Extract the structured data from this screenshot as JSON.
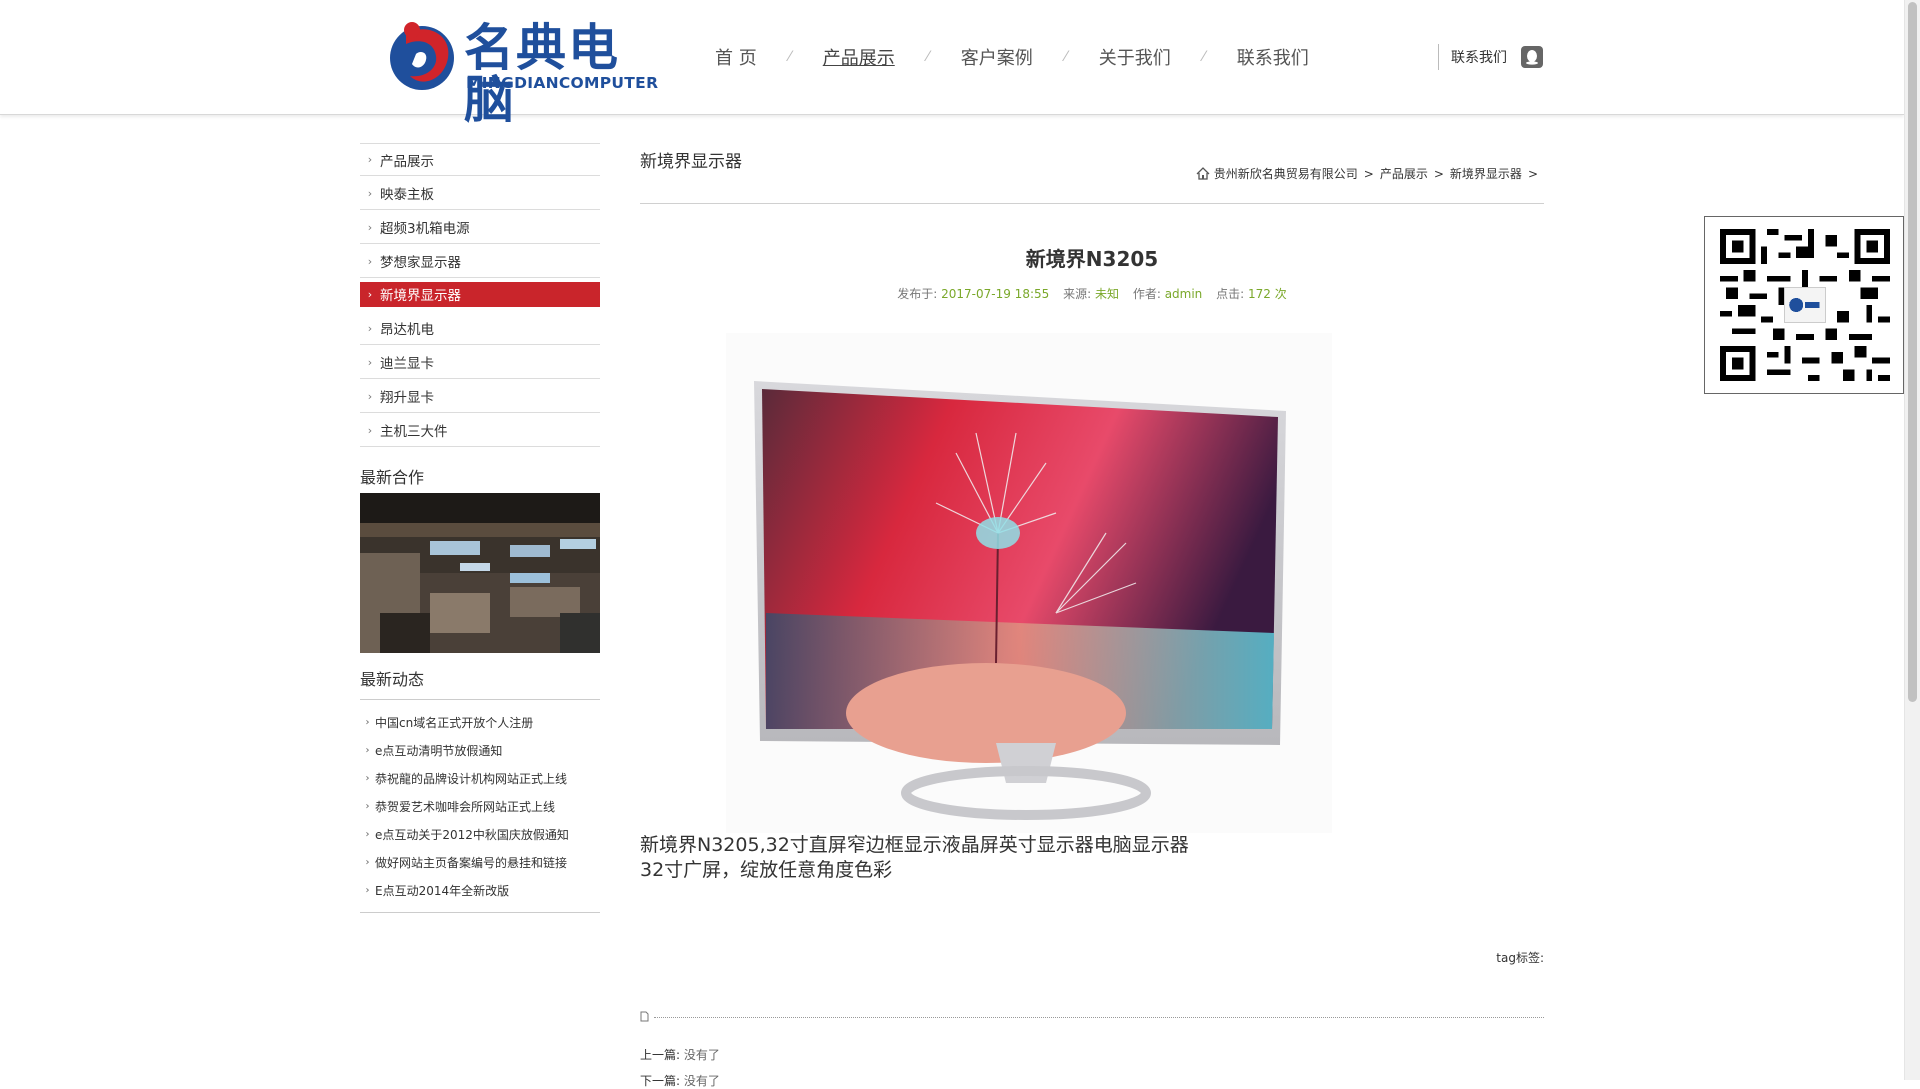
{
  "header": {
    "logo_cn": "名典电脑",
    "logo_en": "MINGDIANCOMPUTER",
    "nav": [
      "首 页",
      "产品展示",
      "客户案例",
      "关于我们",
      "联系我们"
    ],
    "nav_sep": "⁄",
    "contact_label": "联系我们",
    "qq_icon": "qq-icon"
  },
  "sidebar": {
    "categories": [
      "产品展示",
      "映泰主板",
      "超频3机箱电源",
      "梦想家显示器",
      "新境界显示器",
      "昂达机电",
      "迪兰显卡",
      "翔升显卡",
      "主机三大件"
    ],
    "active_category": "新境界显示器",
    "coop_heading": "最新合作",
    "news_heading": "最新动态",
    "news": [
      "中国cn域名正式开放个人注册",
      "e点互动清明节放假通知",
      "恭祝龍的品牌设计机构网站正式上线",
      "恭贺爱艺术咖啡会所网站正式上线",
      "e点互动关于2012中秋国庆放假通知",
      "做好网站主页备案编号的悬挂和链接",
      "E点互动2014年全新改版"
    ]
  },
  "main": {
    "section_title": "新境界显示器",
    "breadcrumb": [
      "贵州新欣名典贸易有限公司",
      "产品展示",
      "新境界显示器"
    ],
    "breadcrumb_sep": ">",
    "article_title": "新境界N3205",
    "meta": {
      "published_label": "发布于:",
      "published": "2017-07-19 18:55",
      "source_label": "来源:",
      "source": "未知",
      "author_label": "作者:",
      "author": "admin",
      "clicks_label": "点击:",
      "clicks": "172 次"
    },
    "desc_line1": "新境界N3205,32寸直屏窄边框显示液晶屏英寸显示器电脑显示器",
    "desc_line2": "32寸广屏，绽放任意角度色彩",
    "tags_label": "tag标签:",
    "prev_label": "上一篇:",
    "prev_value": "没有了",
    "next_label": "下一篇:",
    "next_value": "没有了"
  },
  "colors": {
    "accent_red": "#c9252b",
    "brand_blue": "#1f4f9c",
    "meta_green": "#7aa82a"
  }
}
